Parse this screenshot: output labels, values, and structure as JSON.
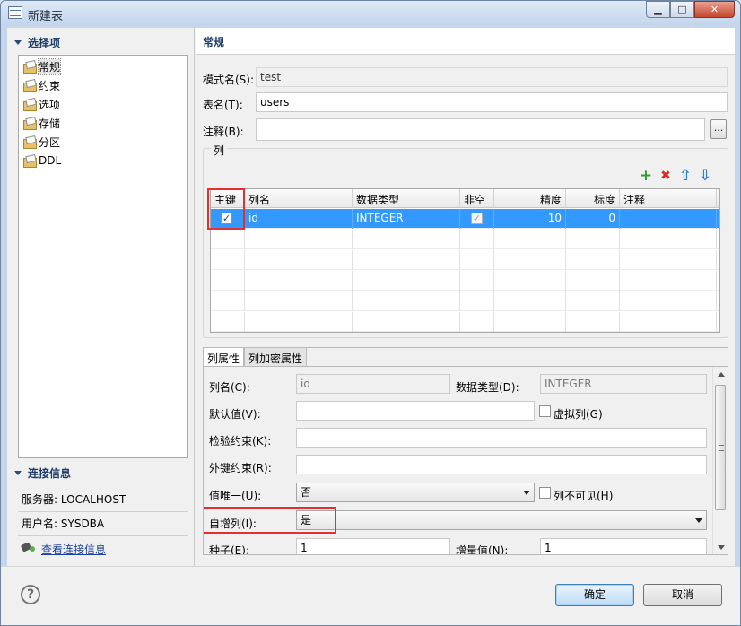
{
  "window": {
    "title": "新建表"
  },
  "left": {
    "nav_header": "选择项",
    "nav_items": [
      "常规",
      "约束",
      "选项",
      "存储",
      "分区",
      "DDL"
    ],
    "conn_header": "连接信息",
    "server_label": "服务器:",
    "server_value": "LOCALHOST",
    "user_label": "用户名:",
    "user_value": "SYSDBA",
    "view_conn_link": "查看连接信息"
  },
  "general": {
    "header": "常规",
    "schema_label": "模式名(S):",
    "schema_value": "test",
    "table_label": "表名(T):",
    "table_value": "users",
    "comment_label": "注释(B):",
    "comment_value": "",
    "browse_label": "..."
  },
  "columns": {
    "group_title": "列",
    "toolbar": {
      "add": "+",
      "delete": "✖",
      "up": "⇧",
      "down": "⇩"
    },
    "headers": [
      "主键",
      "列名",
      "数据类型",
      "非空",
      "精度",
      "标度",
      "注释"
    ],
    "rows": [
      {
        "pk": true,
        "name": "id",
        "type": "INTEGER",
        "notnull": true,
        "precision": "10",
        "scale": "0",
        "comment": ""
      }
    ]
  },
  "props": {
    "tabs": [
      "列属性",
      "列加密属性"
    ],
    "colname_label": "列名(C):",
    "colname_value": "id",
    "datatype_label": "数据类型(D):",
    "datatype_value": "INTEGER",
    "default_label": "默认值(V):",
    "default_value": "",
    "virtual_label": "虚拟列(G)",
    "check_label": "检验约束(K):",
    "check_value": "",
    "fk_label": "外键约束(R):",
    "fk_value": "",
    "unique_label": "值唯一(U):",
    "unique_value": "否",
    "invisible_label": "列不可见(H)",
    "identity_label": "自增列(I):",
    "identity_value": "是",
    "seed_label": "种子(E):",
    "seed_value": "1",
    "increment_label": "增量值(N):",
    "increment_value": "1"
  },
  "footer": {
    "help": "?",
    "ok": "确定",
    "cancel": "取消"
  }
}
